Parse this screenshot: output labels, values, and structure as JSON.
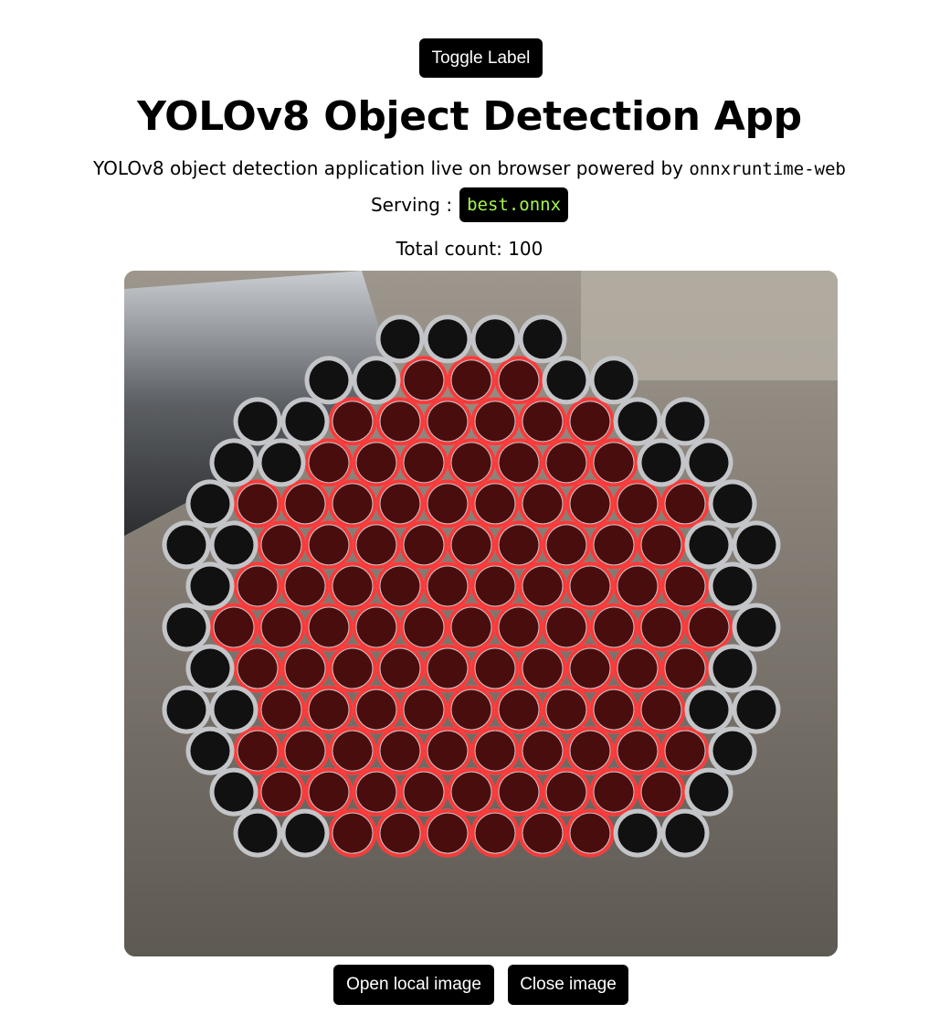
{
  "toolbar": {
    "toggle_label": "Toggle Label"
  },
  "header": {
    "title": "YOLOv8 Object Detection App",
    "subtitle_text": "YOLOv8 object detection application live on browser powered by",
    "subtitle_code": "onnxruntime-web",
    "serving_label": "Serving :",
    "model_name": "best.onnx"
  },
  "result": {
    "count_text": "Total count: 100"
  },
  "actions": {
    "open_label": "Open local image",
    "close_label": "Close image"
  },
  "colors": {
    "detection": "#ff2a2a",
    "model_badge_text": "#a6f54a"
  }
}
